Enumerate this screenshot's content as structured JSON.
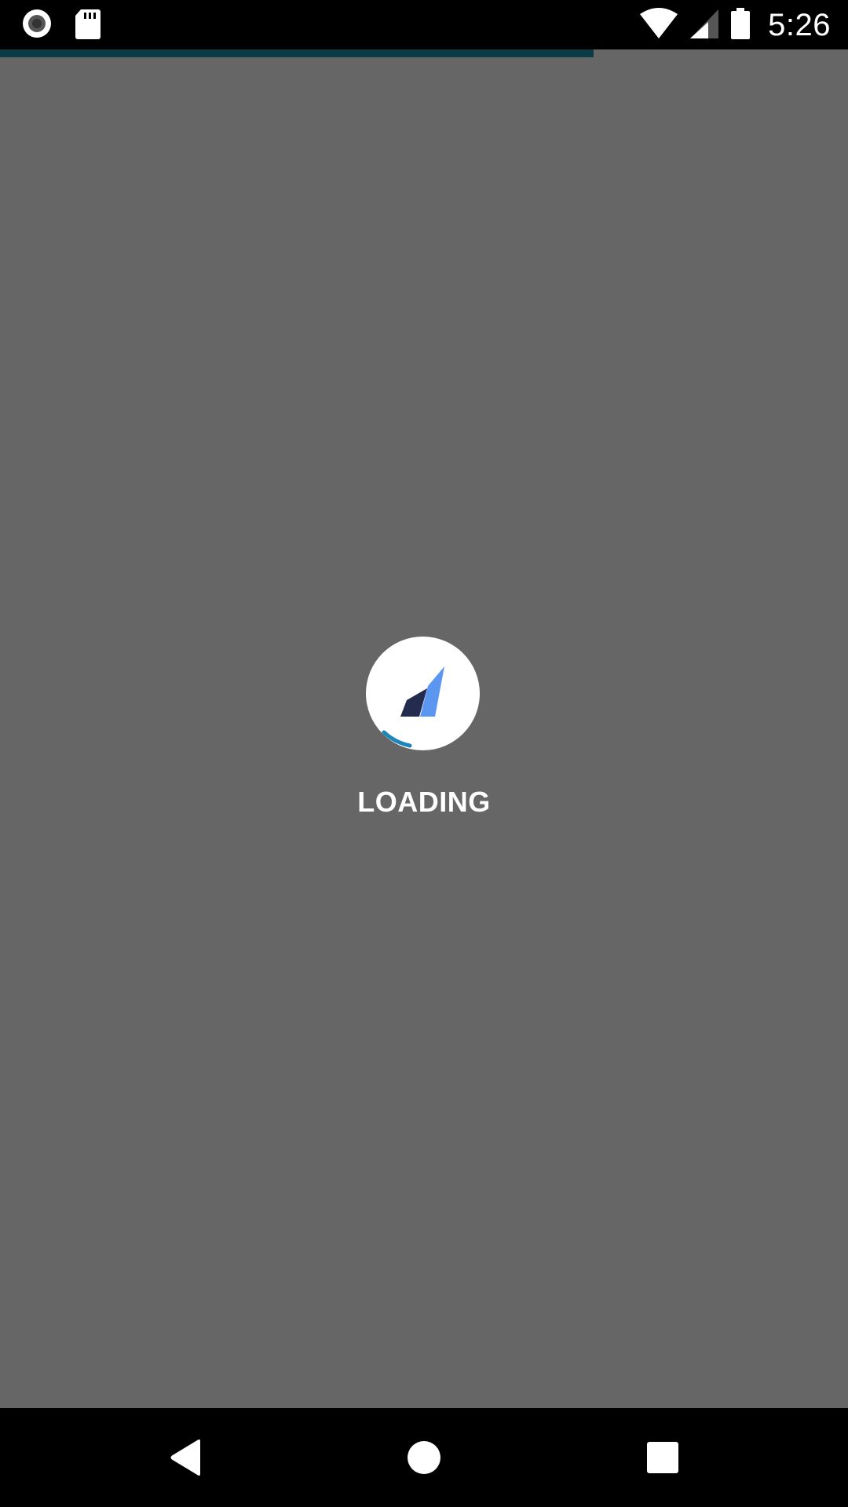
{
  "status_bar": {
    "time": "5:26",
    "left_icons": [
      "record-icon",
      "sd-card-icon"
    ],
    "right_icons": [
      "wifi-icon",
      "cell-signal-icon",
      "battery-icon"
    ]
  },
  "progress": {
    "fraction": 0.7
  },
  "loader": {
    "label": "LOADING",
    "logo_icon": "rocket-logo-icon",
    "spinner_color": "#1c86b8",
    "logo_colors": {
      "light": "#5b97f0",
      "dark": "#232b4e"
    }
  },
  "colors": {
    "background": "#666666",
    "progress_fill": "#0b3c45"
  },
  "nav_bar": {
    "buttons": [
      "back-icon",
      "home-icon",
      "recents-icon"
    ]
  }
}
